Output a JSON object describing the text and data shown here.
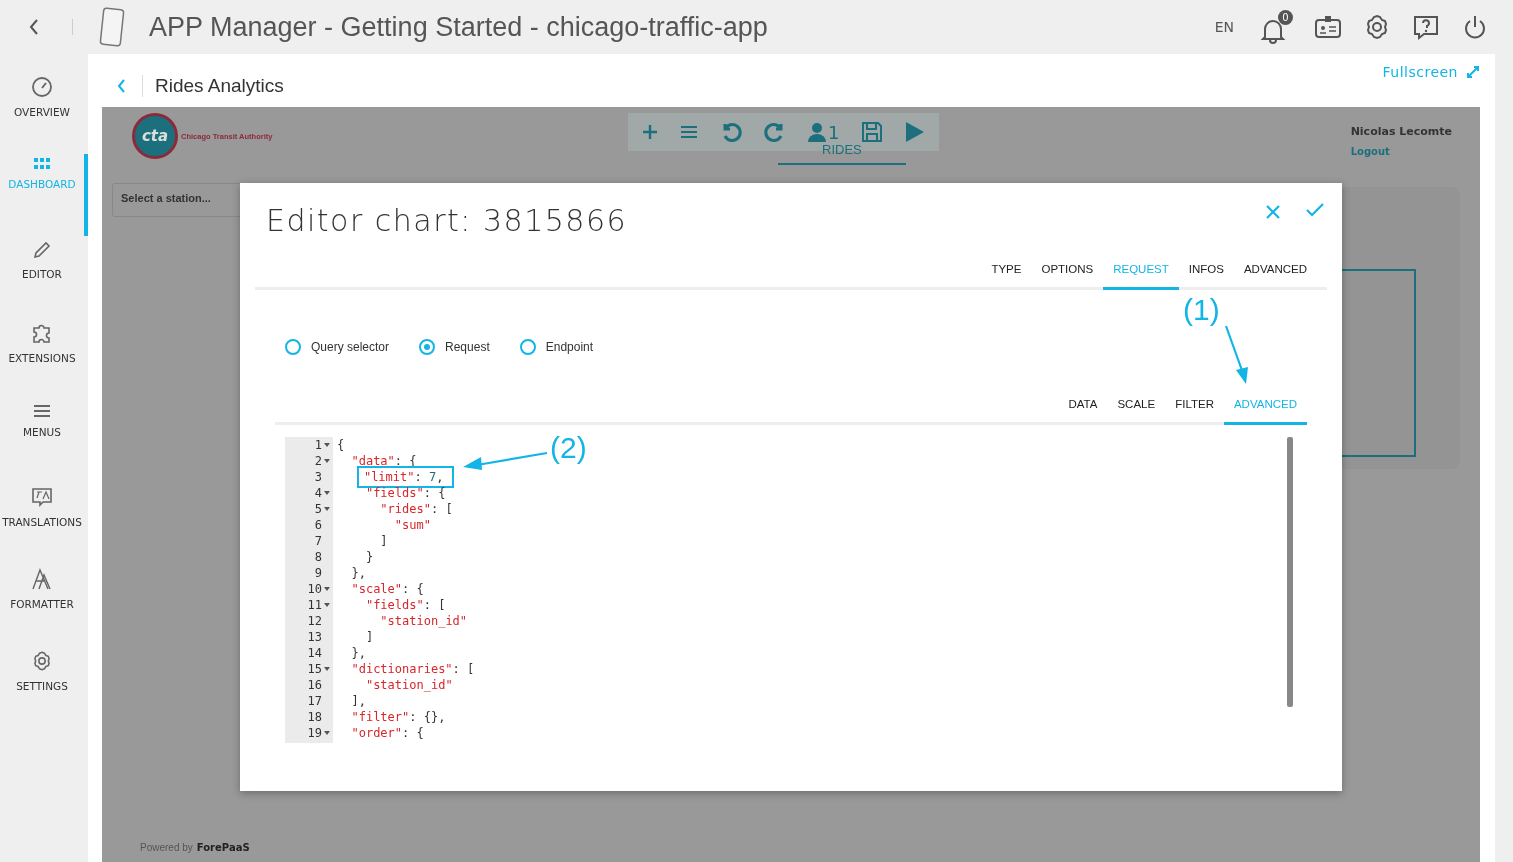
{
  "top_bar": {
    "title": "APP Manager - Getting Started - chicago-traffic-app",
    "language": "EN",
    "notification_count": "0"
  },
  "sidebar": {
    "items": [
      {
        "kind": "overview",
        "label": "OVERVIEW",
        "selected": false
      },
      {
        "kind": "dashboard",
        "label": "DASHBOARD",
        "selected": true
      },
      {
        "kind": "editor",
        "label": "EDITOR",
        "selected": false
      },
      {
        "kind": "extensions",
        "label": "EXTENSIONS",
        "selected": false
      },
      {
        "kind": "menus",
        "label": "MENUS",
        "selected": false
      },
      {
        "kind": "translations",
        "label": "TRANSLATIONS",
        "selected": false
      },
      {
        "kind": "formatter",
        "label": "FORMATTER",
        "selected": false
      },
      {
        "kind": "settings",
        "label": "SETTINGS",
        "selected": false
      }
    ]
  },
  "page": {
    "title": "Rides Analytics",
    "fullscreen": "Fullscreen"
  },
  "dashboard": {
    "logo_text": "cta",
    "logo_caption": "Chicago Transit Authority",
    "user_count": "1",
    "tab": "RIDES",
    "user_name": "Nicolas Lecomte",
    "logout": "Logout",
    "station_select": "Select a station...",
    "powered_by": "Powered by",
    "brand": "ForePaaS"
  },
  "editor": {
    "title": "Editor chart: 3815866",
    "tabs": [
      {
        "label": "TYPE",
        "selected": false
      },
      {
        "label": "OPTIONS",
        "selected": false
      },
      {
        "label": "REQUEST",
        "selected": true
      },
      {
        "label": "INFOS",
        "selected": false
      },
      {
        "label": "ADVANCED",
        "selected": false
      }
    ],
    "modes": [
      {
        "label": "Query selector",
        "selected": false
      },
      {
        "label": "Request",
        "selected": true
      },
      {
        "label": "Endpoint",
        "selected": false
      }
    ],
    "subtabs": [
      {
        "label": "DATA",
        "selected": false
      },
      {
        "label": "SCALE",
        "selected": false
      },
      {
        "label": "FILTER",
        "selected": false
      },
      {
        "label": "ADVANCED",
        "selected": true
      }
    ],
    "code": [
      {
        "number": "1",
        "text": "{",
        "foldable": true,
        "highlighted": false
      },
      {
        "number": "2",
        "text": "  \"data\": {",
        "foldable": true,
        "highlighted": false
      },
      {
        "number": "3",
        "text": "    \"limit\": 7,",
        "foldable": false,
        "highlighted": true
      },
      {
        "number": "4",
        "text": "    \"fields\": {",
        "foldable": true,
        "highlighted": false
      },
      {
        "number": "5",
        "text": "      \"rides\": [",
        "foldable": true,
        "highlighted": false
      },
      {
        "number": "6",
        "text": "        \"sum\"",
        "foldable": false,
        "highlighted": false
      },
      {
        "number": "7",
        "text": "      ]",
        "foldable": false,
        "highlighted": false
      },
      {
        "number": "8",
        "text": "    }",
        "foldable": false,
        "highlighted": false
      },
      {
        "number": "9",
        "text": "  },",
        "foldable": false,
        "highlighted": false
      },
      {
        "number": "10",
        "text": "  \"scale\": {",
        "foldable": true,
        "highlighted": false
      },
      {
        "number": "11",
        "text": "    \"fields\": [",
        "foldable": true,
        "highlighted": false
      },
      {
        "number": "12",
        "text": "      \"station_id\"",
        "foldable": false,
        "highlighted": false
      },
      {
        "number": "13",
        "text": "    ]",
        "foldable": false,
        "highlighted": false
      },
      {
        "number": "14",
        "text": "  },",
        "foldable": false,
        "highlighted": false
      },
      {
        "number": "15",
        "text": "  \"dictionaries\": [",
        "foldable": true,
        "highlighted": false
      },
      {
        "number": "16",
        "text": "    \"station_id\"",
        "foldable": false,
        "highlighted": false
      },
      {
        "number": "17",
        "text": "  ],",
        "foldable": false,
        "highlighted": false
      },
      {
        "number": "18",
        "text": "  \"filter\": {},",
        "foldable": false,
        "highlighted": false
      },
      {
        "number": "19",
        "text": "  \"order\": {",
        "foldable": true,
        "highlighted": false
      }
    ],
    "annotations": [
      {
        "label": "(1)"
      },
      {
        "label": "(2)"
      }
    ]
  }
}
